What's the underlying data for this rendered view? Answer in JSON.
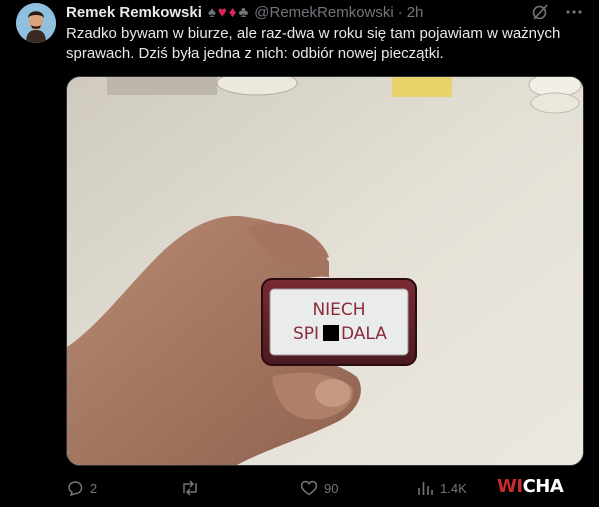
{
  "tweet": {
    "display_name": "Remek Remkowski",
    "handle": "@RemekRemkowski",
    "separator": "·",
    "time": "2h",
    "text": "Rzadko bywam w biurze, ale raz-dwa w roku się tam pojawiam w ważnych sprawach. Dziś była jedna z nich: odbiór nowej pieczątki."
  },
  "icons": {
    "suits": [
      "spade-icon",
      "heart-icon",
      "diamond-icon",
      "club-icon"
    ],
    "grok": "grok-icon",
    "more": "more-icon"
  },
  "media": {
    "stamp_line1": "NIECH",
    "stamp_line2_left": "SPI",
    "stamp_line2_right": "DALA"
  },
  "actions": {
    "replies": "2",
    "reposts": "",
    "likes": "90",
    "views": "1.4K"
  },
  "watermark": {
    "part1": "WI",
    "part2": "CHA"
  },
  "colors": {
    "background": "#000000",
    "text": "#e7e9ea",
    "muted": "#71767b",
    "accent_red": "#e0245e"
  }
}
